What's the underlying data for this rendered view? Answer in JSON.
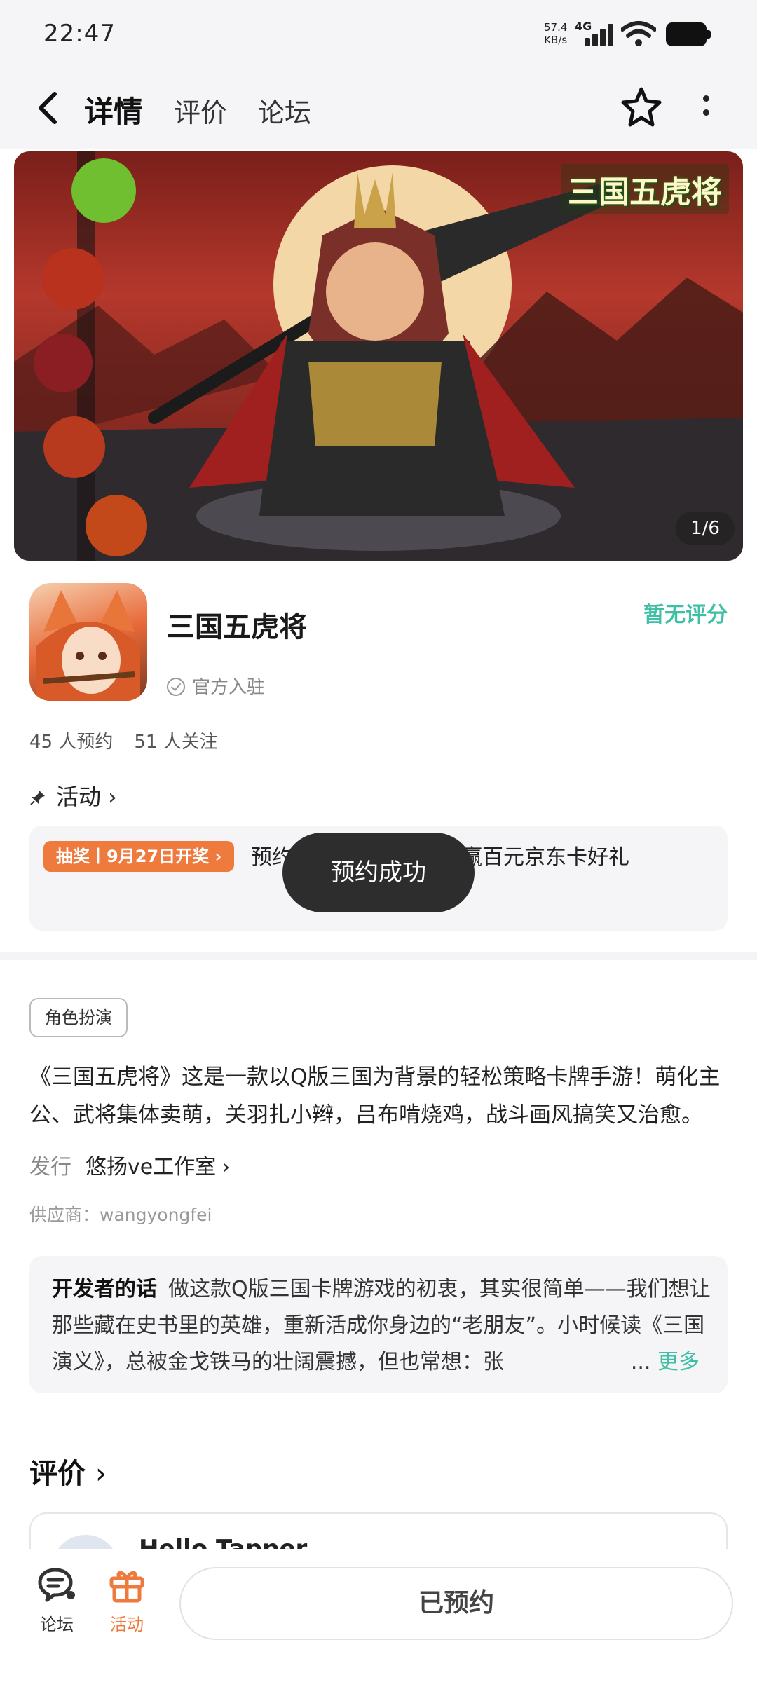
{
  "status_bar": {
    "time": "22:47",
    "net_speed": "57.4\nKB/s",
    "network": "4G"
  },
  "nav": {
    "tabs": [
      {
        "label": "详情",
        "active": true
      },
      {
        "label": "评价",
        "active": false
      },
      {
        "label": "论坛",
        "active": false
      }
    ],
    "icons": [
      "back-icon",
      "star-icon",
      "more-icon"
    ]
  },
  "banner": {
    "logo_text": "三国五虎将",
    "counter": "1/6"
  },
  "app": {
    "name": "三国五虎将",
    "official": "官方入驻",
    "rating": "暂无评分",
    "reservations": "45 人预约",
    "followers": "51 人关注"
  },
  "activity": {
    "title": "活动",
    "badge": "抽奖丨9月27日开奖 ›",
    "text": "预约【预约好礼】预约赢百元京东卡好礼"
  },
  "toast": "预约成功",
  "detail": {
    "tag": "角色扮演",
    "description": "《三国五虎将》这是一款以Q版三国为背景的轻松策略卡牌手游！萌化主公、武将集体卖萌，关羽扎小辫，吕布啃烧鸡，战斗画风搞笑又治愈。",
    "publisher_label": "发行",
    "publisher_name": "悠扬ve工作室",
    "supplier": "供应商：wangyongfei"
  },
  "developer": {
    "label": "开发者的话",
    "text": "做这款Q版三国卡牌游戏的初衷，其实很简单——我们想让那些藏在史书里的英雄，重新活成你身边的“老朋友”。小时候读《三国演义》，总被金戈铁马的壮阔震撼，但也常想：张",
    "more": "更多"
  },
  "reviews": {
    "title": "评价",
    "first_user": "Hello Tapper"
  },
  "bottom_bar": {
    "forum_label": "论坛",
    "activity_label": "活动",
    "action_label": "已预约"
  },
  "colors": {
    "accent": "#3fbfa4",
    "orange": "#ee7a3d",
    "toast_bg": "#2d2d2d"
  }
}
